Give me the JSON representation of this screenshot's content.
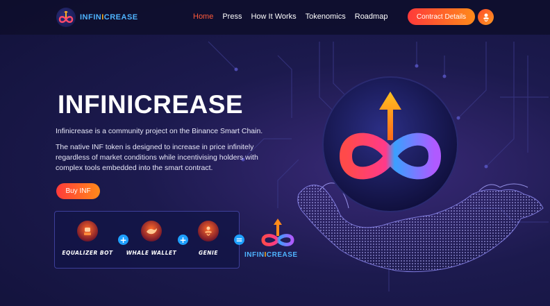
{
  "brand": {
    "name_part1": "INFIN",
    "name_part2": "I",
    "name_part3": "CREASE"
  },
  "nav": {
    "items": [
      {
        "label": "Home",
        "active": true
      },
      {
        "label": "Press",
        "active": false
      },
      {
        "label": "How It Works",
        "active": false
      },
      {
        "label": "Tokenomics",
        "active": false
      },
      {
        "label": "Roadmap",
        "active": false
      }
    ],
    "contract_button": "Contract Details",
    "genie_icon": "genie-icon"
  },
  "hero": {
    "title": "INFINICREASE",
    "subtitle": "Infinicrease is a community project on the Binance Smart Chain.",
    "description": "The native INF token is designed to increase in price infinitely regardless of market conditions while incentivising holders with complex tools embedded into the smart contract.",
    "buy_button": "Buy INF"
  },
  "tools": {
    "items": [
      {
        "label": "EQUALIZER BOT",
        "icon": "robot-icon"
      },
      {
        "label": "WHALE WALLET",
        "icon": "whale-icon"
      },
      {
        "label": "GENIE",
        "icon": "genie-icon"
      }
    ],
    "plus": "+",
    "equals": "=",
    "result_part1": "INFIN",
    "result_part2": "I",
    "result_part3": "CREASE"
  },
  "colors": {
    "accent_orange": "#ff6a1a",
    "accent_blue": "#4fb4ff",
    "accent_gold": "#ffb020",
    "nav_active": "#ff5a3a",
    "background": "#1c1a4e"
  }
}
